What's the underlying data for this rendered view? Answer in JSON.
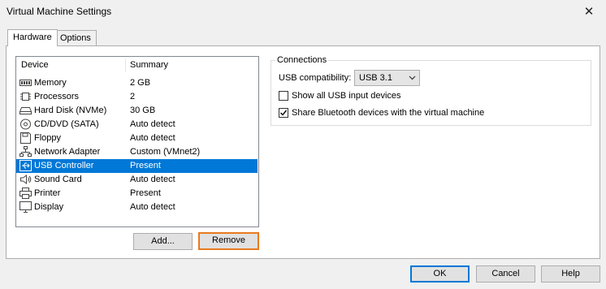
{
  "window": {
    "title": "Virtual Machine Settings"
  },
  "tabs": [
    {
      "label": "Hardware",
      "active": true
    },
    {
      "label": "Options",
      "active": false
    }
  ],
  "device_list": {
    "columns": [
      "Device",
      "Summary"
    ],
    "rows": [
      {
        "icon": "memory-icon",
        "device": "Memory",
        "summary": "2 GB"
      },
      {
        "icon": "processor-icon",
        "device": "Processors",
        "summary": "2"
      },
      {
        "icon": "hard-disk-icon",
        "device": "Hard Disk (NVMe)",
        "summary": "30 GB"
      },
      {
        "icon": "cd-dvd-icon",
        "device": "CD/DVD (SATA)",
        "summary": "Auto detect"
      },
      {
        "icon": "floppy-icon",
        "device": "Floppy",
        "summary": "Auto detect"
      },
      {
        "icon": "network-adapter-icon",
        "device": "Network Adapter",
        "summary": "Custom (VMnet2)"
      },
      {
        "icon": "usb-icon",
        "device": "USB Controller",
        "summary": "Present",
        "selected": true
      },
      {
        "icon": "sound-card-icon",
        "device": "Sound Card",
        "summary": "Auto detect"
      },
      {
        "icon": "printer-icon",
        "device": "Printer",
        "summary": "Present"
      },
      {
        "icon": "display-icon",
        "device": "Display",
        "summary": "Auto detect"
      }
    ]
  },
  "buttons": {
    "add": "Add...",
    "remove": "Remove",
    "ok": "OK",
    "cancel": "Cancel",
    "help": "Help"
  },
  "connections": {
    "legend": "Connections",
    "usb_compat_label": "USB compatibility:",
    "usb_compat_value": "USB 3.1",
    "show_all_usb": {
      "label": "Show all USB input devices",
      "checked": false
    },
    "share_bluetooth": {
      "label": "Share Bluetooth devices with the virtual machine",
      "checked": true
    }
  },
  "colors": {
    "selection": "#0078d7",
    "focus_outline": "#e87a20"
  }
}
